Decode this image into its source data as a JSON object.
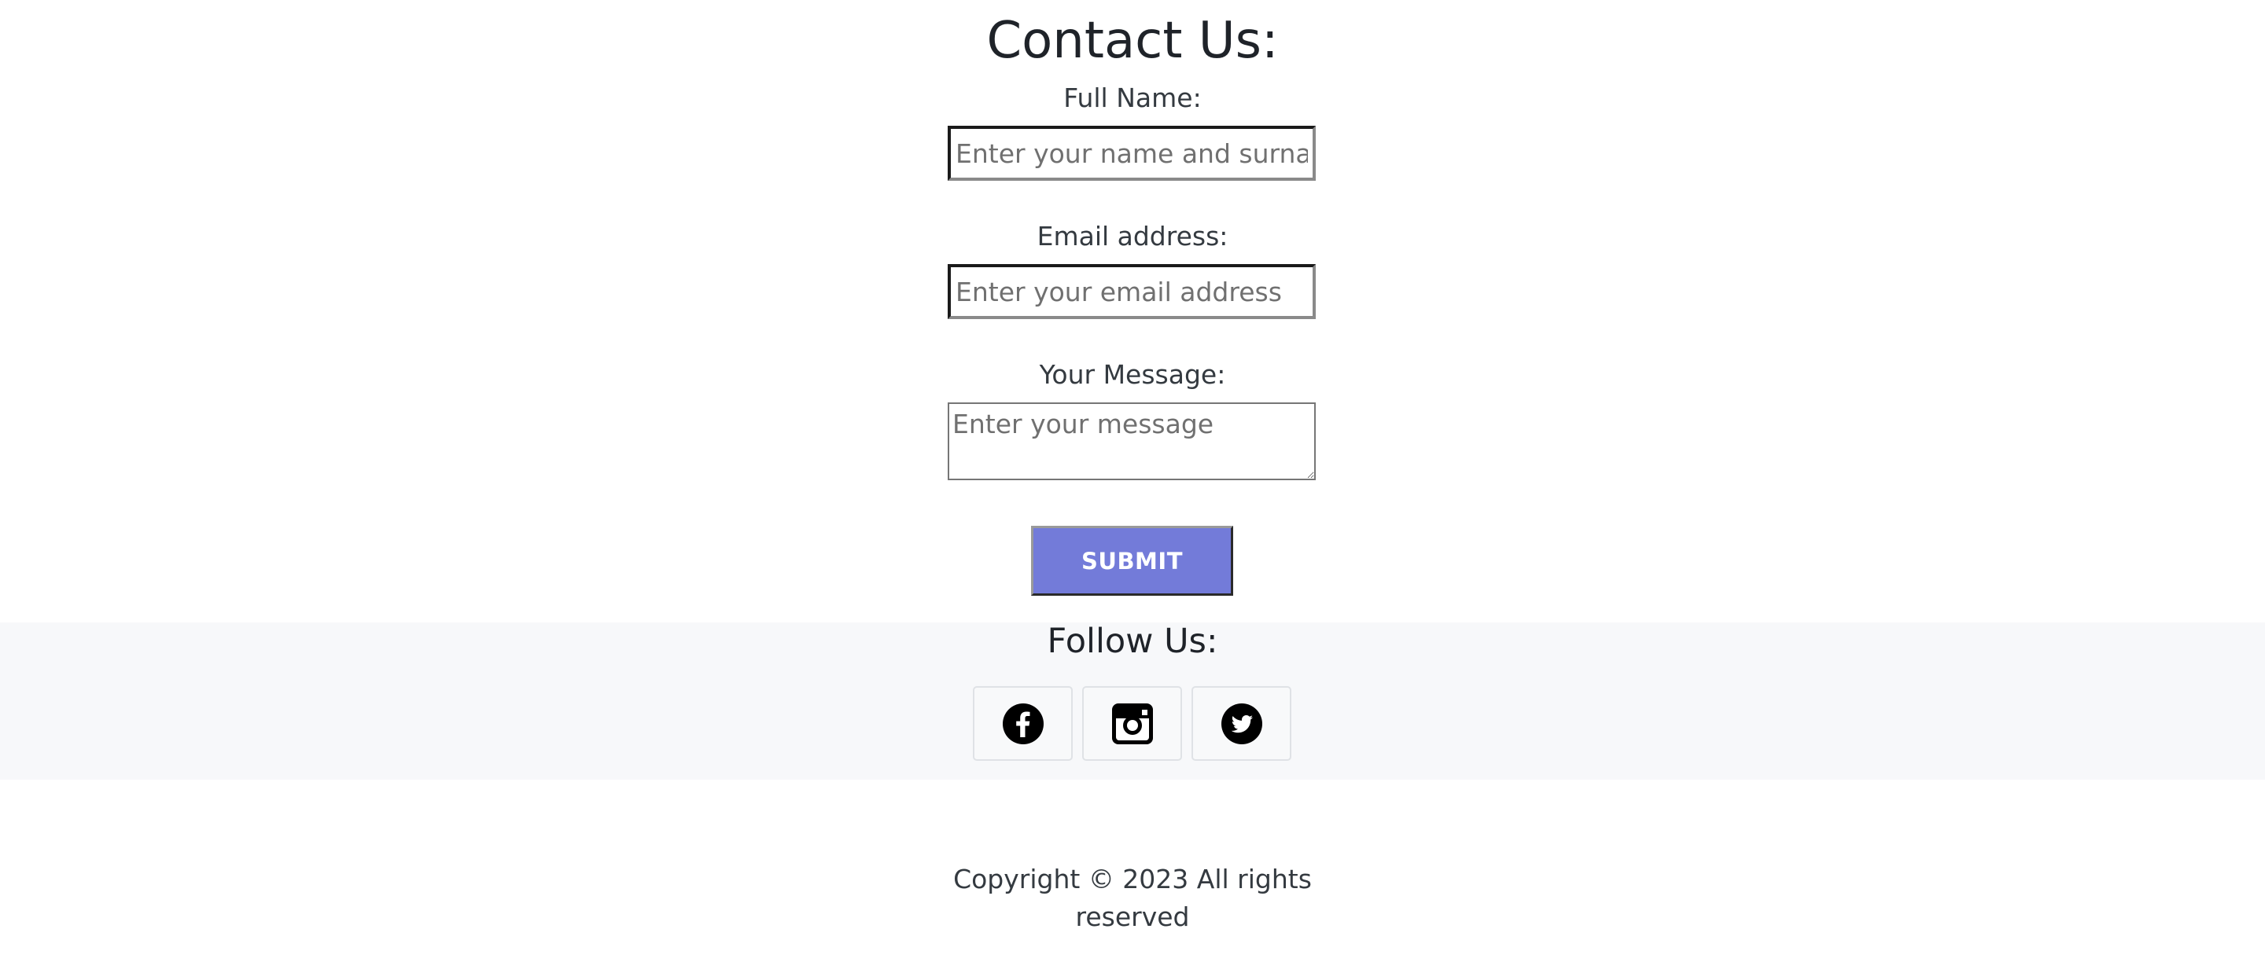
{
  "contact": {
    "title": "Contact Us:",
    "full_name_label": "Full Name:",
    "full_name_placeholder": "Enter your name and surname",
    "email_label": "Email address:",
    "email_placeholder": "Enter your email address",
    "message_label": "Your Message:",
    "message_placeholder": "Enter your message",
    "submit_label": "SUBMIT"
  },
  "follow": {
    "title": "Follow Us:",
    "icons": [
      "facebook-icon",
      "instagram-icon",
      "twitter-icon"
    ]
  },
  "footer": {
    "copyright_line1": "Copyright © 2023 All rights",
    "copyright_line2": "reserved"
  },
  "colors": {
    "submit_background": "#737bd9",
    "follow_background": "#f7f8fa"
  }
}
